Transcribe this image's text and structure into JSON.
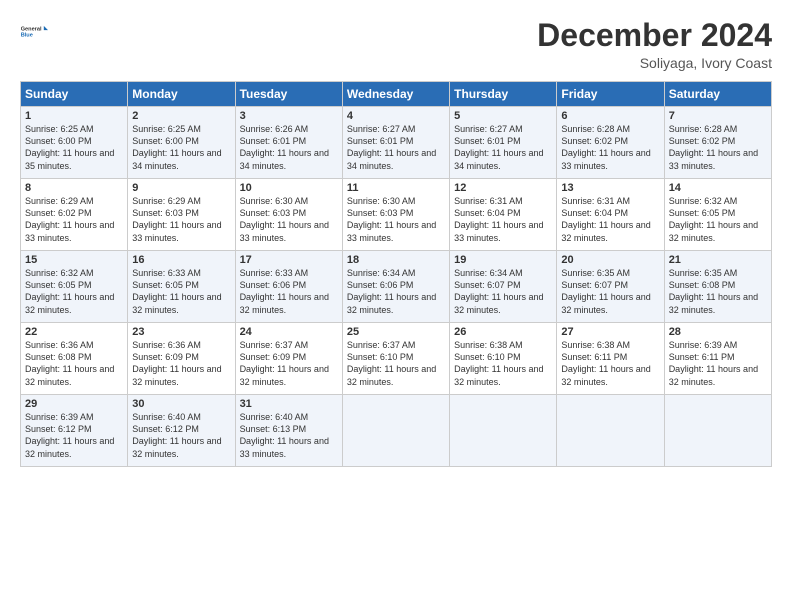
{
  "header": {
    "logo_line1": "General",
    "logo_line2": "Blue",
    "month": "December 2024",
    "location": "Soliyaga, Ivory Coast"
  },
  "days_of_week": [
    "Sunday",
    "Monday",
    "Tuesday",
    "Wednesday",
    "Thursday",
    "Friday",
    "Saturday"
  ],
  "weeks": [
    [
      {
        "day": "1",
        "info": "Sunrise: 6:25 AM\nSunset: 6:00 PM\nDaylight: 11 hours and 35 minutes."
      },
      {
        "day": "2",
        "info": "Sunrise: 6:25 AM\nSunset: 6:00 PM\nDaylight: 11 hours and 34 minutes."
      },
      {
        "day": "3",
        "info": "Sunrise: 6:26 AM\nSunset: 6:01 PM\nDaylight: 11 hours and 34 minutes."
      },
      {
        "day": "4",
        "info": "Sunrise: 6:27 AM\nSunset: 6:01 PM\nDaylight: 11 hours and 34 minutes."
      },
      {
        "day": "5",
        "info": "Sunrise: 6:27 AM\nSunset: 6:01 PM\nDaylight: 11 hours and 34 minutes."
      },
      {
        "day": "6",
        "info": "Sunrise: 6:28 AM\nSunset: 6:02 PM\nDaylight: 11 hours and 33 minutes."
      },
      {
        "day": "7",
        "info": "Sunrise: 6:28 AM\nSunset: 6:02 PM\nDaylight: 11 hours and 33 minutes."
      }
    ],
    [
      {
        "day": "8",
        "info": "Sunrise: 6:29 AM\nSunset: 6:02 PM\nDaylight: 11 hours and 33 minutes."
      },
      {
        "day": "9",
        "info": "Sunrise: 6:29 AM\nSunset: 6:03 PM\nDaylight: 11 hours and 33 minutes."
      },
      {
        "day": "10",
        "info": "Sunrise: 6:30 AM\nSunset: 6:03 PM\nDaylight: 11 hours and 33 minutes."
      },
      {
        "day": "11",
        "info": "Sunrise: 6:30 AM\nSunset: 6:03 PM\nDaylight: 11 hours and 33 minutes."
      },
      {
        "day": "12",
        "info": "Sunrise: 6:31 AM\nSunset: 6:04 PM\nDaylight: 11 hours and 33 minutes."
      },
      {
        "day": "13",
        "info": "Sunrise: 6:31 AM\nSunset: 6:04 PM\nDaylight: 11 hours and 32 minutes."
      },
      {
        "day": "14",
        "info": "Sunrise: 6:32 AM\nSunset: 6:05 PM\nDaylight: 11 hours and 32 minutes."
      }
    ],
    [
      {
        "day": "15",
        "info": "Sunrise: 6:32 AM\nSunset: 6:05 PM\nDaylight: 11 hours and 32 minutes."
      },
      {
        "day": "16",
        "info": "Sunrise: 6:33 AM\nSunset: 6:05 PM\nDaylight: 11 hours and 32 minutes."
      },
      {
        "day": "17",
        "info": "Sunrise: 6:33 AM\nSunset: 6:06 PM\nDaylight: 11 hours and 32 minutes."
      },
      {
        "day": "18",
        "info": "Sunrise: 6:34 AM\nSunset: 6:06 PM\nDaylight: 11 hours and 32 minutes."
      },
      {
        "day": "19",
        "info": "Sunrise: 6:34 AM\nSunset: 6:07 PM\nDaylight: 11 hours and 32 minutes."
      },
      {
        "day": "20",
        "info": "Sunrise: 6:35 AM\nSunset: 6:07 PM\nDaylight: 11 hours and 32 minutes."
      },
      {
        "day": "21",
        "info": "Sunrise: 6:35 AM\nSunset: 6:08 PM\nDaylight: 11 hours and 32 minutes."
      }
    ],
    [
      {
        "day": "22",
        "info": "Sunrise: 6:36 AM\nSunset: 6:08 PM\nDaylight: 11 hours and 32 minutes."
      },
      {
        "day": "23",
        "info": "Sunrise: 6:36 AM\nSunset: 6:09 PM\nDaylight: 11 hours and 32 minutes."
      },
      {
        "day": "24",
        "info": "Sunrise: 6:37 AM\nSunset: 6:09 PM\nDaylight: 11 hours and 32 minutes."
      },
      {
        "day": "25",
        "info": "Sunrise: 6:37 AM\nSunset: 6:10 PM\nDaylight: 11 hours and 32 minutes."
      },
      {
        "day": "26",
        "info": "Sunrise: 6:38 AM\nSunset: 6:10 PM\nDaylight: 11 hours and 32 minutes."
      },
      {
        "day": "27",
        "info": "Sunrise: 6:38 AM\nSunset: 6:11 PM\nDaylight: 11 hours and 32 minutes."
      },
      {
        "day": "28",
        "info": "Sunrise: 6:39 AM\nSunset: 6:11 PM\nDaylight: 11 hours and 32 minutes."
      }
    ],
    [
      {
        "day": "29",
        "info": "Sunrise: 6:39 AM\nSunset: 6:12 PM\nDaylight: 11 hours and 32 minutes."
      },
      {
        "day": "30",
        "info": "Sunrise: 6:40 AM\nSunset: 6:12 PM\nDaylight: 11 hours and 32 minutes."
      },
      {
        "day": "31",
        "info": "Sunrise: 6:40 AM\nSunset: 6:13 PM\nDaylight: 11 hours and 33 minutes."
      },
      {
        "day": "",
        "info": ""
      },
      {
        "day": "",
        "info": ""
      },
      {
        "day": "",
        "info": ""
      },
      {
        "day": "",
        "info": ""
      }
    ]
  ]
}
